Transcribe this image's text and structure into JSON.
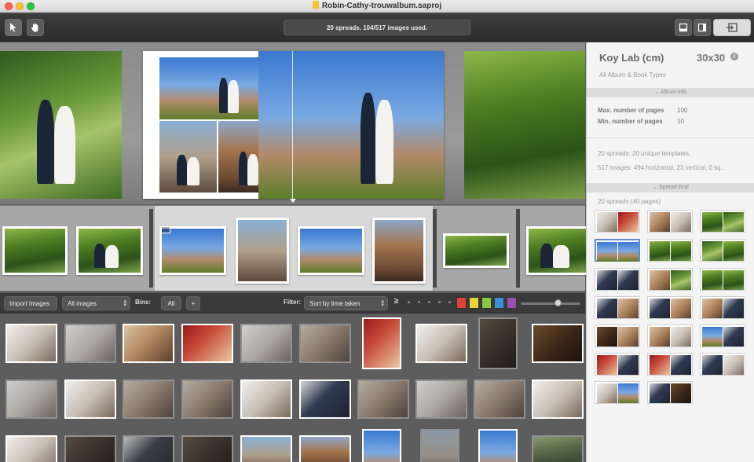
{
  "window": {
    "title": "Robin-Cathy-trouwalbum.saproj"
  },
  "toolbar": {
    "status": "20 spreads. 104/517 images used.",
    "tools": [
      "pointer-tool",
      "hand-tool"
    ],
    "view_buttons": [
      "single-page-view",
      "sidebar-view"
    ],
    "export_button": "export"
  },
  "browser": {
    "import_label": "Import Images",
    "filter_select": "All images",
    "bins_label": "Bins:",
    "bin_all": "All",
    "bin_add": "+",
    "filter_label": "Filter:",
    "sort_select": "Sort by time taken",
    "rating_operator": "≥",
    "color_labels": [
      "#e0413a",
      "#e8d43a",
      "#8cc63f",
      "#3a8fd6",
      "#9b4fb5"
    ]
  },
  "panel": {
    "album_type": "Koy Lab (cm)",
    "album_size": "30x30",
    "album_category": "All Album & Book Types",
    "album_info_header": "Album Info",
    "max_pages_label": "Max. number of pages",
    "max_pages_value": "100",
    "min_pages_label": "Min. number of pages",
    "min_pages_value": "10",
    "spreads_summary": "20 spreads: 20 unique templates.",
    "images_summary": "517 images: 494 horizontal, 23 vertical, 0 sq...",
    "spread_grid_header": "Spread Grid",
    "spread_grid_count": "20 spreads (40 pages)"
  },
  "colors": {
    "accent": "#5a8dd6",
    "toolbar": "#333333",
    "panel": "#f4f4f4"
  }
}
